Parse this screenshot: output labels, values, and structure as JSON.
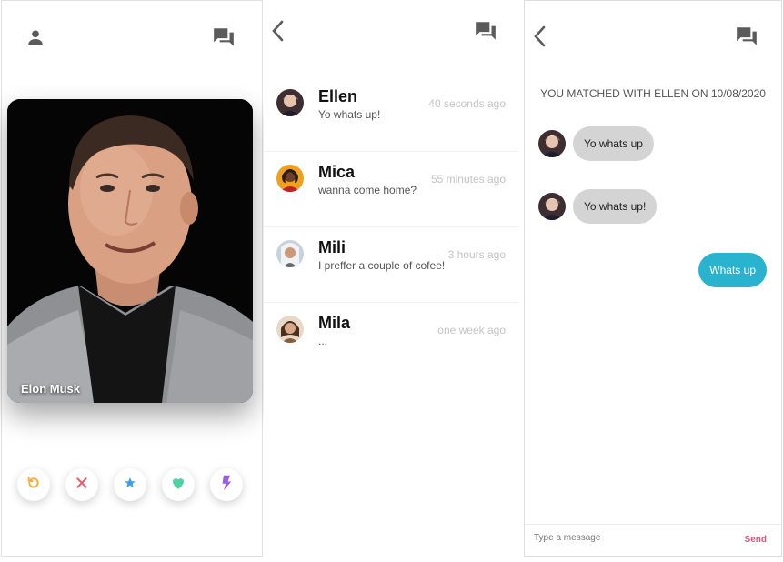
{
  "swipe": {
    "profile_name": "Elon Musk",
    "actions": [
      {
        "icon": "undo-icon",
        "color": "#f5b041"
      },
      {
        "icon": "close-icon",
        "color": "#ec5a6a"
      },
      {
        "icon": "star-icon",
        "color": "#3a9ff0"
      },
      {
        "icon": "heart-icon",
        "color": "#4fd1a1"
      },
      {
        "icon": "lightning-icon",
        "color": "#9b5de5"
      }
    ]
  },
  "matches": {
    "conversations": [
      {
        "name": "Ellen",
        "message": "Yo whats up!",
        "time": "40 seconds ago"
      },
      {
        "name": "Mica",
        "message": "wanna come home?",
        "time": "55 minutes ago"
      },
      {
        "name": "Mili",
        "message": "I preffer a couple of cofee!",
        "time": "3 hours ago"
      },
      {
        "name": "Mila",
        "message": "...",
        "time": "one week ago"
      }
    ]
  },
  "chat": {
    "match_banner": "YOU MATCHED WITH ELLEN ON 10/08/2020",
    "messages": [
      {
        "text": "Yo whats up",
        "from": "them"
      },
      {
        "text": "Yo whats up!",
        "from": "them"
      },
      {
        "text": "Whats up",
        "from": "me"
      }
    ],
    "input_placeholder": "Type a message",
    "send_label": "Send"
  },
  "colors": {
    "icon_gray": "#5b5b5b",
    "outgoing_bubble": "#2ab3cf",
    "incoming_bubble": "#d4d4d4",
    "send_accent": "#e8507a"
  }
}
